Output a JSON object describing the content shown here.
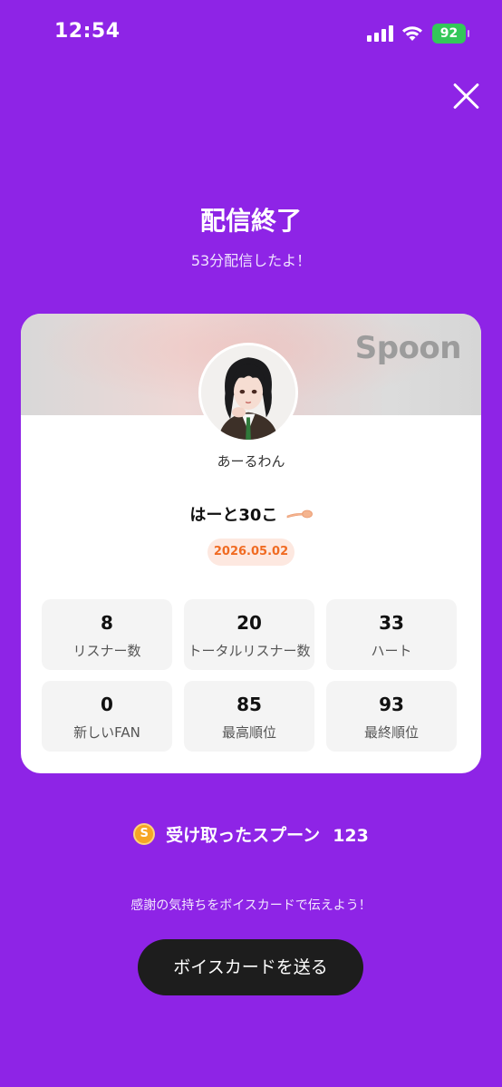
{
  "status_bar": {
    "time": "12:54",
    "battery": "92",
    "icons": [
      "signal-icon",
      "wifi-icon",
      "battery-icon"
    ]
  },
  "header": {
    "close_icon": "close-icon",
    "title": "配信終了",
    "subtitle": "53分配信したよ！"
  },
  "card": {
    "brand": "Spoon",
    "username": "あーるわん",
    "stream_title": "はーと30こ",
    "stream_title_emoji": "spoon-emoji",
    "date": "2026.05.02",
    "stats": [
      {
        "value": "8",
        "label": "リスナー数"
      },
      {
        "value": "20",
        "label": "トータルリスナー数"
      },
      {
        "value": "33",
        "label": "ハート"
      },
      {
        "value": "0",
        "label": "新しいFAN"
      },
      {
        "value": "85",
        "label": "最高順位"
      },
      {
        "value": "93",
        "label": "最終順位"
      }
    ]
  },
  "spoons": {
    "coin_symbol": "S",
    "label": "受け取ったスプーン",
    "count": "123"
  },
  "voice_card": {
    "hint": "感謝の気持ちをボイスカードで伝えよう！",
    "button_label": "ボイスカードを送る"
  },
  "colors": {
    "background": "#8e24e6",
    "date_badge_text": "#f06b22",
    "date_badge_bg": "#fde8e0",
    "coin": "#f6a524",
    "button_bg": "#1d1d1d"
  }
}
